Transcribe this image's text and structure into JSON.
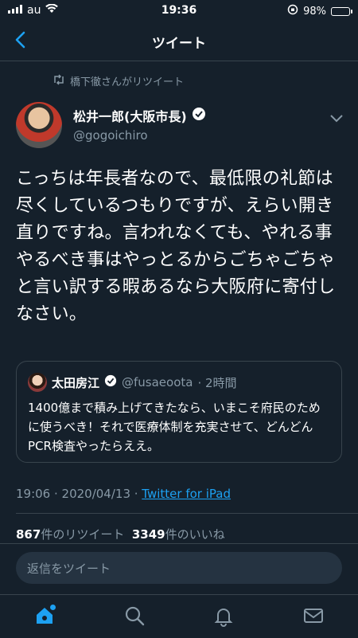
{
  "status_bar": {
    "carrier": "au",
    "time": "19:36",
    "battery": "98%"
  },
  "nav": {
    "title": "ツイート"
  },
  "retweet_context": "橋下徹さんがリツイート",
  "tweet": {
    "author_name": "松井一郎(大阪市長)",
    "author_handle": "@gogoichiro",
    "text": "こっちは年長者なので、最低限の礼節は尽くしているつもりですが、えらい開き直りですね。言われなくても、やれる事やるべき事はやっとるからごちゃごちゃと言い訳する暇あるなら大阪府に寄付しなさい。",
    "timestamp": "19:06 · 2020/04/13 · ",
    "source": "Twitter for iPad",
    "retweets_count": "867",
    "retweets_label": "件のリツイート",
    "likes_count": "3349",
    "likes_label": "件のいいね"
  },
  "quote": {
    "name": "太田房江",
    "handle": "@fusaeoota",
    "time": "· 2時間",
    "text": "1400億まで積み上げてきたなら、いまこそ府民のために使うべき！それで医療体制を充実させて、どんどんPCR検査やったらええ。"
  },
  "reply": {
    "placeholder": "返信をツイート"
  },
  "tabs": [
    "home-icon",
    "search-icon",
    "notifications-icon",
    "messages-icon"
  ],
  "colors": {
    "background": "#15202b",
    "accent": "#1da1f2",
    "muted": "#8899a6",
    "border": "#38444d"
  }
}
